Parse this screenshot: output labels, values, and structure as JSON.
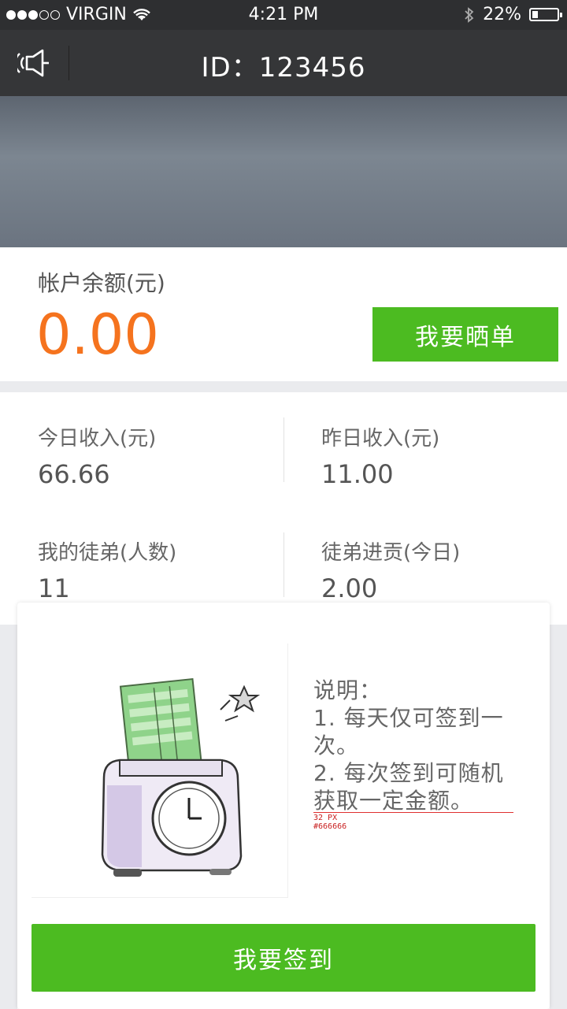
{
  "status_bar": {
    "carrier": "VIRGIN",
    "time": "4:21 PM",
    "battery": "22%",
    "battery_level": 0.22,
    "signal_bars": 3,
    "signal_total": 5
  },
  "header": {
    "title": "ID：123456",
    "speaker_icon": "speaker-icon"
  },
  "balance": {
    "label": "帐户余额(元)",
    "amount": "0.00",
    "share_button": "我要晒单",
    "amount_color": "#f5731e",
    "accent_color": "#4cbb21"
  },
  "stats": [
    {
      "label": "今日收入(元)",
      "value": "66.66"
    },
    {
      "label": "昨日收入(元)",
      "value": "11.00"
    },
    {
      "label": "我的徒弟(人数)",
      "value": "11"
    },
    {
      "label": "徒弟进贡(今日)",
      "value": "2.00"
    }
  ],
  "checkin": {
    "desc_lines": [
      "说明：",
      "1. 每天仅可签到一",
      "次。",
      "2. 每次签到可随机",
      "获取一定金额。"
    ],
    "annotation_size": "32 PX",
    "annotation_color": "#666666",
    "sign_button": "我要签到",
    "illustration": "time-clock-icon"
  }
}
